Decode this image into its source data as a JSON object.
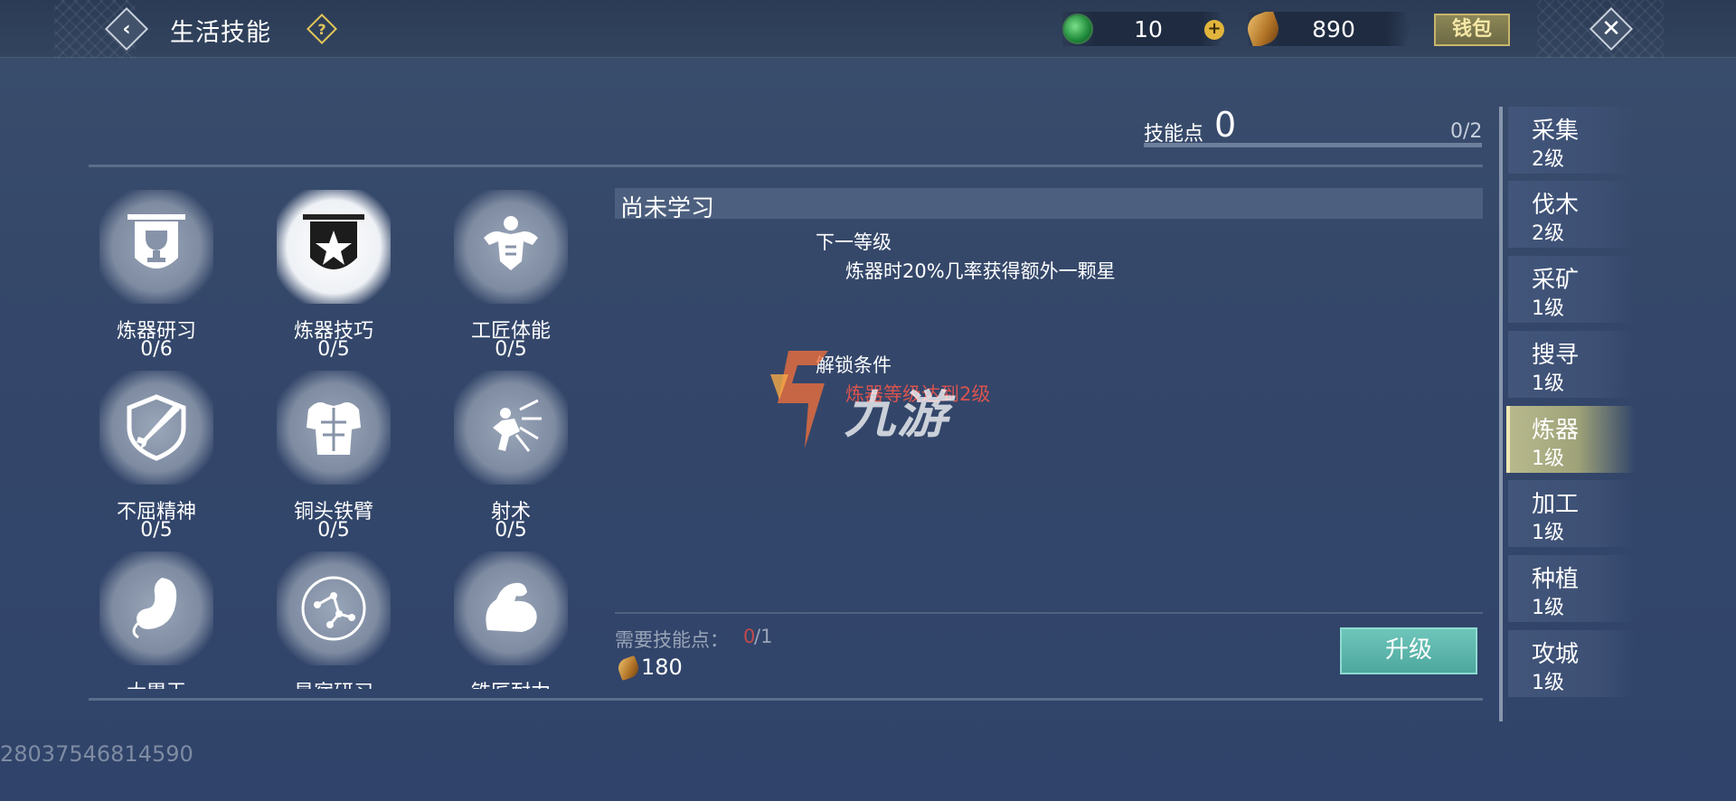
{
  "header": {
    "title": "生活技能",
    "back_icon": "chevron-left-icon",
    "help_label": "?",
    "jade_value": "10",
    "leaf_value": "890",
    "plus_label": "+",
    "wallet_label": "钱包",
    "close_label": "✕"
  },
  "skill_points": {
    "label": "技能点",
    "value": "0",
    "capacity": "0/2"
  },
  "skills": [
    {
      "name": "炼器研习",
      "level": "0/6",
      "icon": "trophy-banner-icon"
    },
    {
      "name": "炼器技巧",
      "level": "0/5",
      "icon": "star-banner-icon"
    },
    {
      "name": "工匠体能",
      "level": "0/5",
      "icon": "muscle-torso-icon"
    },
    {
      "name": "不屈精神",
      "level": "0/5",
      "icon": "sword-shield-icon"
    },
    {
      "name": "铜头铁臂",
      "level": "0/5",
      "icon": "armor-icon"
    },
    {
      "name": "射术",
      "level": "0/5",
      "icon": "archery-icon"
    },
    {
      "name": "大胃王",
      "level": "",
      "icon": "stomach-icon"
    },
    {
      "name": "星宿研习",
      "level": "",
      "icon": "constellation-icon"
    },
    {
      "name": "铁匠耐力",
      "level": "",
      "icon": "flexed-arm-icon"
    }
  ],
  "detail": {
    "status": "尚未学习",
    "next_level_label": "下一等级",
    "next_level_desc": "炼器时20%几率获得额外一颗星",
    "unlock_label": "解锁条件",
    "unlock_condition": "炼器等级达到2级",
    "need_label": "需要技能点：",
    "need_current": "0",
    "need_max": "/1",
    "cost": "180",
    "upgrade_label": "升级"
  },
  "watermark": {
    "text": "九游"
  },
  "tabs": [
    {
      "name": "采集",
      "level": "2级"
    },
    {
      "name": "伐木",
      "level": "2级"
    },
    {
      "name": "采矿",
      "level": "1级"
    },
    {
      "name": "搜寻",
      "level": "1级"
    },
    {
      "name": "炼器",
      "level": "1级",
      "active": true
    },
    {
      "name": "加工",
      "level": "1级"
    },
    {
      "name": "种植",
      "level": "1级"
    },
    {
      "name": "攻城",
      "level": "1级"
    }
  ],
  "uid": "28037546814590",
  "colors": {
    "background": "#34476a",
    "accent_gold": "#e3c65a",
    "upgrade_teal": "#5db7ac",
    "warning_red": "#d9534f"
  }
}
